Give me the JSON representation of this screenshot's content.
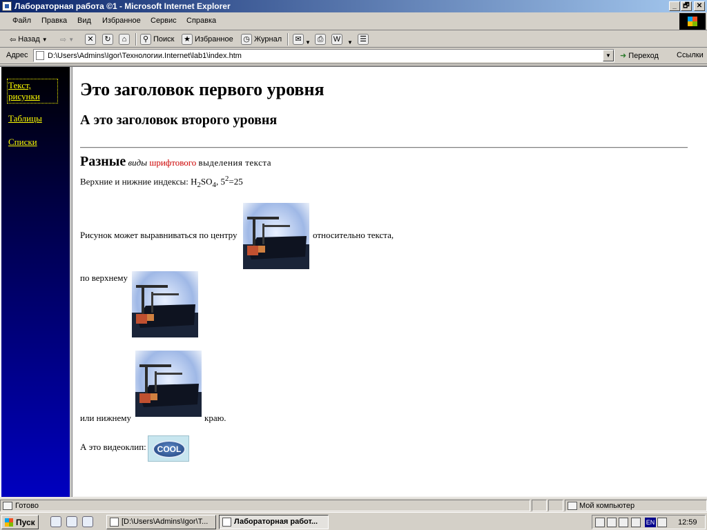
{
  "window": {
    "title": "Лабораторная работа ©1 - Microsoft Internet Explorer",
    "controls": {
      "minimize": "_",
      "maximize": "🗗",
      "close": "✕"
    }
  },
  "menu": [
    "Файл",
    "Правка",
    "Вид",
    "Избранное",
    "Сервис",
    "Справка"
  ],
  "toolbar": {
    "back": "Назад",
    "search": "Поиск",
    "favorites": "Избранное",
    "history": "Журнал"
  },
  "address": {
    "label": "Адрес",
    "url": "D:\\Users\\Admins\\Igor\\Технологии.Internet\\lab1\\index.htm",
    "go": "Переход",
    "links": "Ссылки"
  },
  "nav": {
    "links": [
      "Текст, рисунки",
      "Таблицы",
      "Списки"
    ]
  },
  "page": {
    "h1": "Это заголовок первого уровня",
    "h2": "А это заголовок второго уровня",
    "fonts": {
      "big": "Разные",
      "italic": "виды",
      "red": "шрифтового",
      "spaced": "выделения текста"
    },
    "indices": {
      "prefix": "Верхние и нижние индексы: H",
      "sub1": "2",
      "mid1": "SO",
      "sub2": "4",
      "mid2": ", 5",
      "sup": "2",
      "suffix": "=25"
    },
    "img_center_before": "Рисунок может выравниваться по центру",
    "img_center_after": "относительно текста,",
    "img_top": "по верхнему",
    "img_bottom_before": "или нижнему",
    "img_bottom_after": "краю.",
    "video_label": "А это видеоклип:",
    "cool_badge": "COOL"
  },
  "status": {
    "text": "Готово",
    "zone": "Мой компьютер"
  },
  "taskbar": {
    "start": "Пуск",
    "tasks": [
      "[D:\\Users\\Admins\\Igor\\T...",
      "Лабораторная работ..."
    ],
    "lang": "EN",
    "clock": "12:59"
  }
}
